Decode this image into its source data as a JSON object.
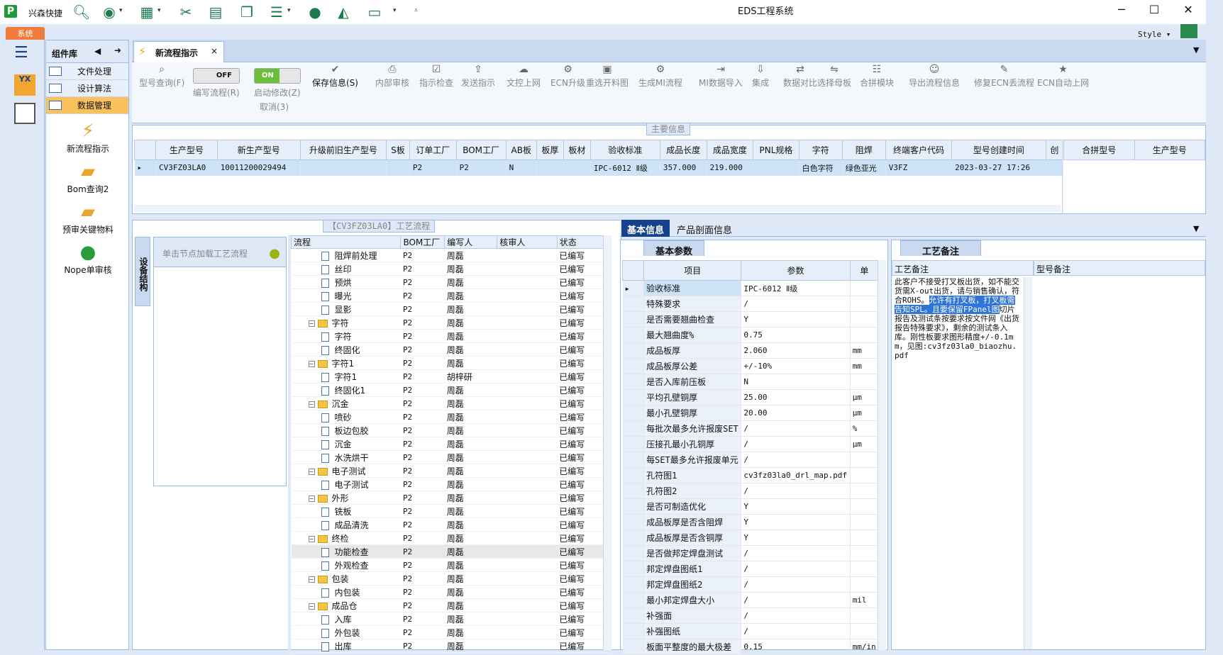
{
  "app": {
    "quick_label": "兴森快捷",
    "window_title": "EDS工程系统",
    "system_tab": "系统",
    "style_label": "Style"
  },
  "quick_icons": [
    "search-icon",
    "lifebuoy-icon",
    "table-icon",
    "scissors-icon",
    "film-icon",
    "clipboard-icon",
    "list-icon",
    "user-icon",
    "chart-icon",
    "monitor-icon"
  ],
  "sidebar": {
    "title": "组件库",
    "menu": [
      "文件处理",
      "设计算法",
      "数据管理"
    ],
    "nav": [
      "新流程指示",
      "Bom查询2",
      "预审关键物料",
      "Nope单审核"
    ]
  },
  "tab": {
    "label": "新流程指示"
  },
  "ribbon": {
    "buttons": [
      "型号查询(F)",
      "编写流程(R)",
      "启动修改(Z)",
      "保存信息(S)",
      "内部审核",
      "指示检查",
      "发送指示",
      "文控上网",
      "ECN升级",
      "重选开料图",
      "生成MI流程",
      "MI数据导入",
      "集成",
      "数据对比",
      "选择母板",
      "合拼模块",
      "导出流程信息",
      "修复ECN丢流程",
      "ECN自动上网"
    ],
    "cancel": "取消(3)",
    "toggle_off": "OFF",
    "toggle_on": "ON"
  },
  "main_info": {
    "legend": "主要信息",
    "columns": [
      "生产型号",
      "新生产型号",
      "升级前旧生产型号",
      "S板",
      "订单工厂",
      "BOM工厂",
      "AB板",
      "板厚",
      "板材",
      "验收标准",
      "成品长度",
      "成品宽度",
      "PNL规格",
      "字符",
      "阻焊",
      "终端客户代码",
      "型号创建时间",
      "创"
    ],
    "row": [
      "CV3FZ03LA0",
      "10011200029494",
      "",
      "",
      "P2",
      "P2",
      "N",
      "",
      "",
      "IPC-6012 Ⅱ级",
      "357.000",
      "219.000",
      "",
      "白色字符",
      "绿色亚光",
      "V3FZ",
      "2023-03-27 17:26",
      ""
    ],
    "side_columns": [
      "合拼型号",
      "生产型号"
    ]
  },
  "flow": {
    "legend": "【CV3FZ03LA0】工艺流程",
    "vtab": "设备结构",
    "search_hint": "单击节点加载工艺流程",
    "columns": [
      "流程",
      "BOM工厂",
      "编写人",
      "核审人",
      "状态"
    ],
    "rows": [
      {
        "name": "阻焊前处理",
        "level": 1,
        "bom": "P2",
        "writer": "周磊",
        "status": "已编写"
      },
      {
        "name": "丝印",
        "level": 1,
        "bom": "P2",
        "writer": "周磊",
        "status": "已编写"
      },
      {
        "name": "预烘",
        "level": 1,
        "bom": "P2",
        "writer": "周磊",
        "status": "已编写"
      },
      {
        "name": "曝光",
        "level": 1,
        "bom": "P2",
        "writer": "周磊",
        "status": "已编写"
      },
      {
        "name": "显影",
        "level": 1,
        "bom": "P2",
        "writer": "周磊",
        "status": "已编写"
      },
      {
        "name": "字符",
        "level": 0,
        "bom": "P2",
        "writer": "周磊",
        "status": "已编写"
      },
      {
        "name": "字符",
        "level": 1,
        "bom": "P2",
        "writer": "周磊",
        "status": "已编写"
      },
      {
        "name": "终固化",
        "level": 1,
        "bom": "P2",
        "writer": "周磊",
        "status": "已编写"
      },
      {
        "name": "字符1",
        "level": 0,
        "bom": "P2",
        "writer": "周磊",
        "status": "已编写"
      },
      {
        "name": "字符1",
        "level": 1,
        "bom": "P2",
        "writer": "胡梓研",
        "status": "已编写"
      },
      {
        "name": "终固化1",
        "level": 1,
        "bom": "P2",
        "writer": "周磊",
        "status": "已编写"
      },
      {
        "name": "沉金",
        "level": 0,
        "bom": "P2",
        "writer": "周磊",
        "status": "已编写"
      },
      {
        "name": "喷砂",
        "level": 1,
        "bom": "P2",
        "writer": "周磊",
        "status": "已编写"
      },
      {
        "name": "板边包胶",
        "level": 1,
        "bom": "P2",
        "writer": "周磊",
        "status": "已编写"
      },
      {
        "name": "沉金",
        "level": 1,
        "bom": "P2",
        "writer": "周磊",
        "status": "已编写"
      },
      {
        "name": "水洗烘干",
        "level": 1,
        "bom": "P2",
        "writer": "周磊",
        "status": "已编写"
      },
      {
        "name": "电子测试",
        "level": 0,
        "bom": "P2",
        "writer": "周磊",
        "status": "已编写"
      },
      {
        "name": "电子测试",
        "level": 1,
        "bom": "P2",
        "writer": "周磊",
        "status": "已编写"
      },
      {
        "name": "外形",
        "level": 0,
        "bom": "P2",
        "writer": "周磊",
        "status": "已编写"
      },
      {
        "name": "铣板",
        "level": 1,
        "bom": "P2",
        "writer": "周磊",
        "status": "已编写"
      },
      {
        "name": "成品清洗",
        "level": 1,
        "bom": "P2",
        "writer": "周磊",
        "status": "已编写"
      },
      {
        "name": "终检",
        "level": 0,
        "bom": "P2",
        "writer": "周磊",
        "status": "已编写"
      },
      {
        "name": "功能检查",
        "level": 1,
        "bom": "P2",
        "writer": "周磊",
        "status": "已编写"
      },
      {
        "name": "外观检查",
        "level": 1,
        "bom": "P2",
        "writer": "周磊",
        "status": "已编写"
      },
      {
        "name": "包装",
        "level": 0,
        "bom": "P2",
        "writer": "周磊",
        "status": "已编写"
      },
      {
        "name": "内包装",
        "level": 1,
        "bom": "P2",
        "writer": "周磊",
        "status": "已编写"
      },
      {
        "name": "成品仓",
        "level": 0,
        "bom": "P2",
        "writer": "周磊",
        "status": "已编写"
      },
      {
        "name": "入库",
        "level": 1,
        "bom": "P2",
        "writer": "周磊",
        "status": "已编写"
      },
      {
        "name": "外包装",
        "level": 1,
        "bom": "P2",
        "writer": "周磊",
        "status": "已编写"
      },
      {
        "name": "出库",
        "level": 1,
        "bom": "P2",
        "writer": "周磊",
        "status": "已编写"
      }
    ]
  },
  "info_tabs": [
    "基本信息",
    "产品剖面信息"
  ],
  "params": {
    "subtab": "基本参数",
    "columns": [
      "项目",
      "参数",
      "单"
    ],
    "rows": [
      [
        "验收标准",
        "IPC-6012 Ⅱ级",
        ""
      ],
      [
        "特殊要求",
        "/",
        ""
      ],
      [
        "是否需要翘曲检查",
        "Y",
        ""
      ],
      [
        "最大翘曲度%",
        "0.75",
        ""
      ],
      [
        "成品板厚",
        "2.060",
        "mm"
      ],
      [
        "成品板厚公差",
        "+/-10%",
        "mm"
      ],
      [
        "是否入库前压板",
        "N",
        ""
      ],
      [
        "平均孔壁铜厚",
        "25.00",
        "μm"
      ],
      [
        "最小孔壁铜厚",
        "20.00",
        "μm"
      ],
      [
        "每批次最多允许报废SET",
        "/",
        "%"
      ],
      [
        "压接孔最小孔铜厚",
        "/",
        "μm"
      ],
      [
        "每SET最多允许报废单元",
        "/",
        ""
      ],
      [
        "孔符图1",
        "cv3fz03la0_drl_map.pdf",
        ""
      ],
      [
        "孔符图2",
        "/",
        ""
      ],
      [
        "是否可制造优化",
        "Y",
        ""
      ],
      [
        "成品板厚是否含阻焊",
        "Y",
        ""
      ],
      [
        "成品板厚是否含铜厚",
        "Y",
        ""
      ],
      [
        "是否做邦定焊盘测试",
        "/",
        ""
      ],
      [
        "邦定焊盘图纸1",
        "/",
        ""
      ],
      [
        "邦定焊盘图纸2",
        "/",
        ""
      ],
      [
        "最小邦定焊盘大小",
        "/",
        "mil"
      ],
      [
        "补强面",
        "/",
        ""
      ],
      [
        "补强图纸",
        "/",
        ""
      ],
      [
        "板面平整度的最大极差",
        "0.15",
        "mm/in"
      ]
    ]
  },
  "notes": {
    "subtab": "工艺备注",
    "col1": "工艺备注",
    "col2": "型号备注",
    "text_pre": "此客户不接受打叉板出货，如不能交货需X-out出货，请与销售确认，符合ROHS。",
    "text_hl": "允许有打叉板，打叉板需告知SPL。且要保留FPanel图",
    "text_post": "切片报告及测试条按要求按文件网《出货报告特殊要求》，剩余的测试条入库。刚性板要求图形精度+/-0.1mm，见图:cv3fz03la0_biaozhu.pdf"
  }
}
